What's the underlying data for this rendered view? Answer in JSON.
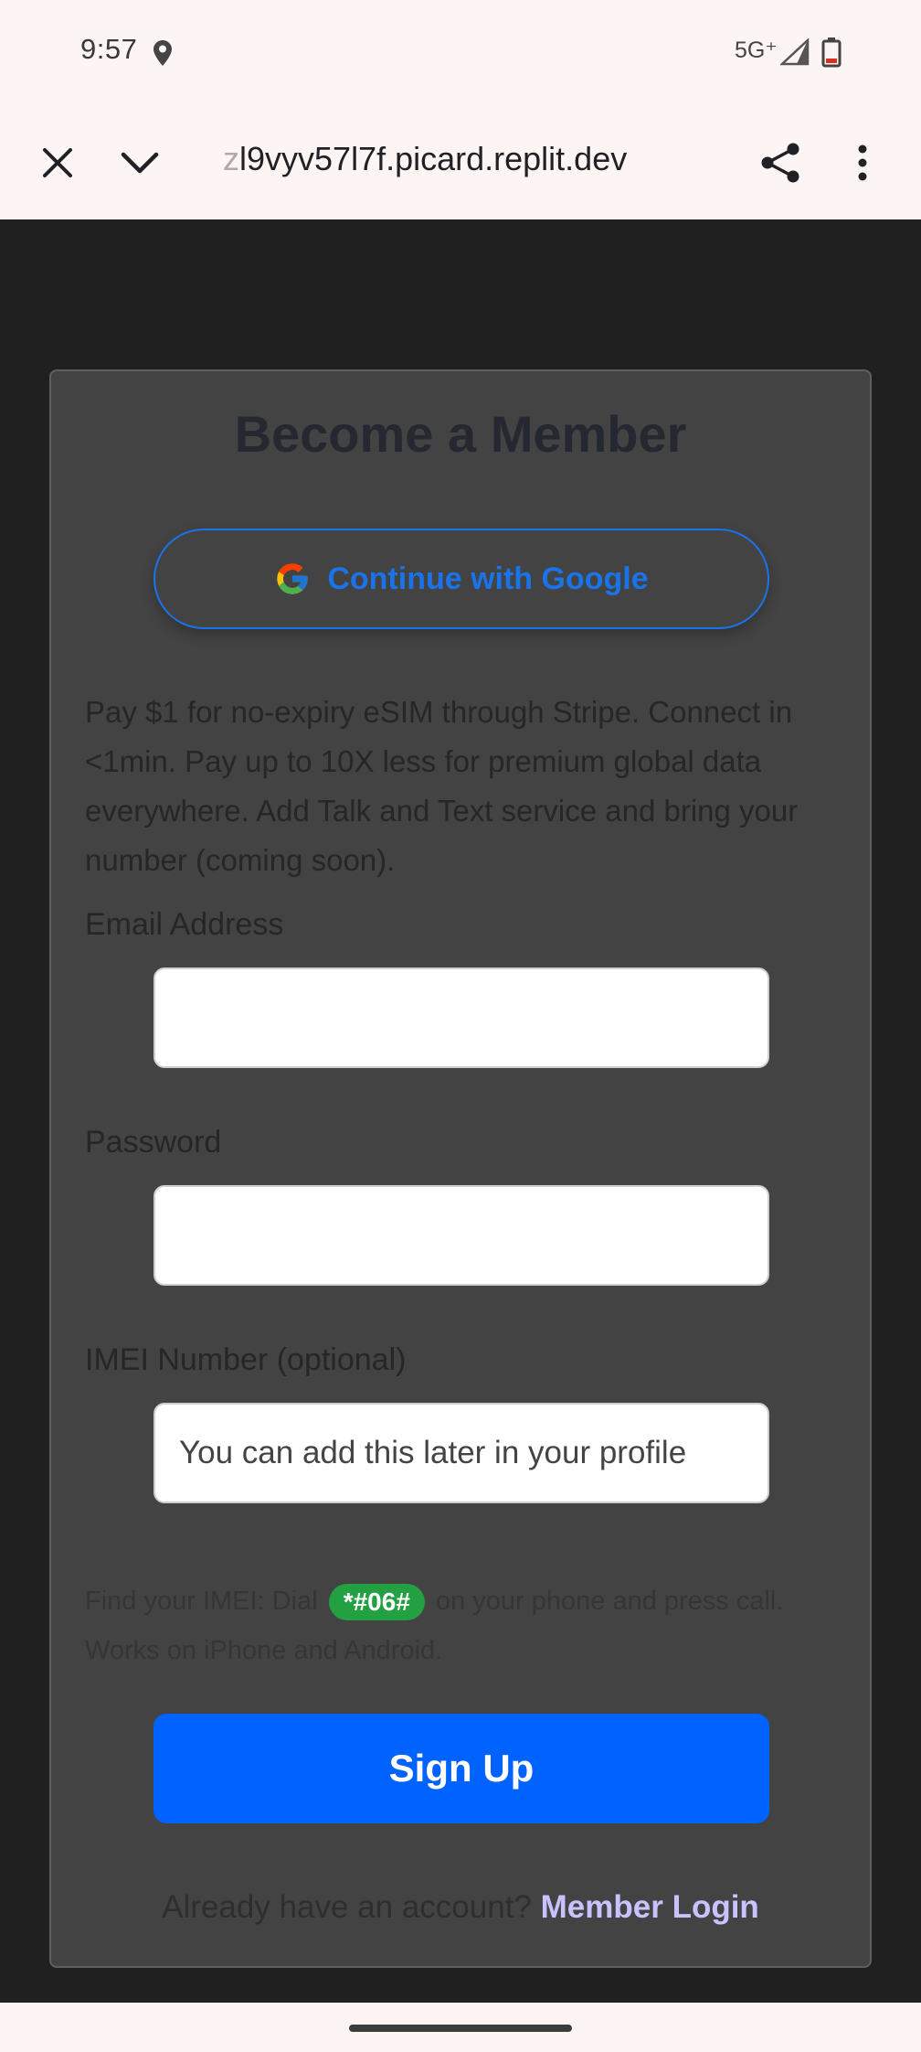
{
  "status_bar": {
    "time": "9:57",
    "network": "5G⁺",
    "icons": [
      "location-icon",
      "signal-icon",
      "battery-icon"
    ]
  },
  "browser": {
    "url_fade": "z",
    "url_main": "l9vyv57l7f.picard.replit.dev",
    "icons": [
      "close-icon",
      "chevron-down-icon",
      "share-icon",
      "more-vert-icon"
    ]
  },
  "form": {
    "title": "Become a Member",
    "google_label": "Continue with Google",
    "description": "Pay $1 for no-expiry eSIM through Stripe. Connect in <1min. Pay up to 10X less for premium global data everywhere. Add Talk and Text service and bring your number (coming soon).",
    "email_label": "Email Address",
    "email_value": "",
    "password_label": "Password",
    "password_value": "",
    "imei_label": "IMEI Number (optional)",
    "imei_placeholder": "You can add this later in your profile",
    "hint_before": "Find your IMEI: Dial",
    "hint_code": "*#06#",
    "hint_after": "on your phone and press call. Works on iPhone and Android.",
    "signup_label": "Sign Up",
    "login_prompt": "Already have an account?",
    "login_link": "Member Login"
  },
  "colors": {
    "accent_blue": "#0062ff",
    "google_blue": "#1a73e8",
    "code_green": "#22a042",
    "link_lavender": "#c7c3ff",
    "card_bg": "#434343",
    "page_bg": "#202020",
    "chrome_bg": "#fdf5f3"
  }
}
